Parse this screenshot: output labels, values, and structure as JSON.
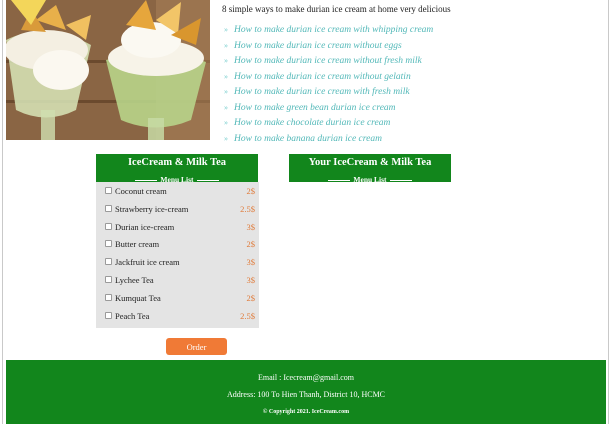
{
  "article": {
    "intro": "8 simple ways to make durian ice cream at home very delicious",
    "links": [
      "How to make durian ice cream with whipping cream",
      "How to make durian ice cream without eggs",
      "How to make durian ice cream without fresh milk",
      "How to make durian ice cream without gelatin",
      "How to make durian ice cream with fresh milk",
      "How to make green bean durian ice cream",
      "How to make chocolate durian ice cream",
      "How to make banana durian ice cream"
    ]
  },
  "menu": {
    "title": "IceCream & Milk Tea",
    "subtitle": "Menu List",
    "items": [
      {
        "name": "Coconut cream",
        "price": "2$"
      },
      {
        "name": "Strawberry ice-cream",
        "price": "2.5$"
      },
      {
        "name": "Durian ice-cream",
        "price": "3$"
      },
      {
        "name": "Butter cream",
        "price": "2$"
      },
      {
        "name": "Jackfruit ice cream",
        "price": "3$"
      },
      {
        "name": "Lychee Tea",
        "price": "3$"
      },
      {
        "name": "Kumquat Tea",
        "price": "2$"
      },
      {
        "name": "Peach Tea",
        "price": "2.5$"
      }
    ],
    "order_label": "Order"
  },
  "your_menu": {
    "title": "Your IceCream & Milk Tea",
    "subtitle": "Menu List"
  },
  "footer": {
    "email": "Email : Icecream@gmail.com",
    "address": "Address: 100 To Hien Thanh, District 10, HCMC",
    "copyright": "© Copyright 2021. IceCream.com"
  },
  "colors": {
    "brand_green": "#12861c",
    "link": "#52b8b8",
    "price": "#e07b3a",
    "order_button": "#f07a36"
  },
  "icons": {
    "link_bullet": "arrow-right-icon",
    "item_checkbox": "checkbox-icon"
  }
}
